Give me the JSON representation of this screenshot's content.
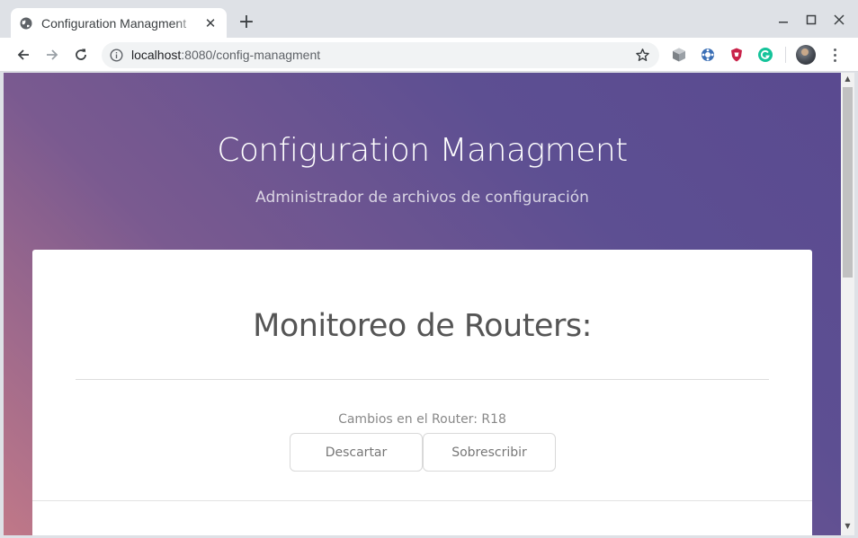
{
  "browser": {
    "tab": {
      "title": "Configuration Managment",
      "close_glyph": "✕"
    },
    "new_tab_glyph": "+",
    "window_controls": {
      "minimize": "—",
      "maximize": "☐",
      "close": "✕"
    },
    "address_bar": {
      "host": "localhost",
      "path": ":8080/config-managment"
    },
    "icons": [
      "globe-icon",
      "back-icon",
      "forward-icon",
      "reload-icon",
      "info-icon",
      "star-icon",
      "cube-extension-icon",
      "blue-extension-icon",
      "shield-extension-icon",
      "grammarly-extension-icon",
      "profile-avatar",
      "kebab-menu-icon"
    ],
    "scroll_glyphs": {
      "up": "▲",
      "down": "▼"
    }
  },
  "page": {
    "hero": {
      "title": "Configuration Managment",
      "subtitle": "Administrador de archivos de configuración"
    },
    "card": {
      "title": "Monitoreo de Routers:",
      "status": "Cambios en el Router: R18",
      "buttons": {
        "discard": "Descartar",
        "overwrite": "Sobrescribir"
      }
    },
    "colors": {
      "gradient_start": "#5a4a90",
      "gradient_end": "#c07888",
      "card_bg": "#ffffff"
    }
  }
}
